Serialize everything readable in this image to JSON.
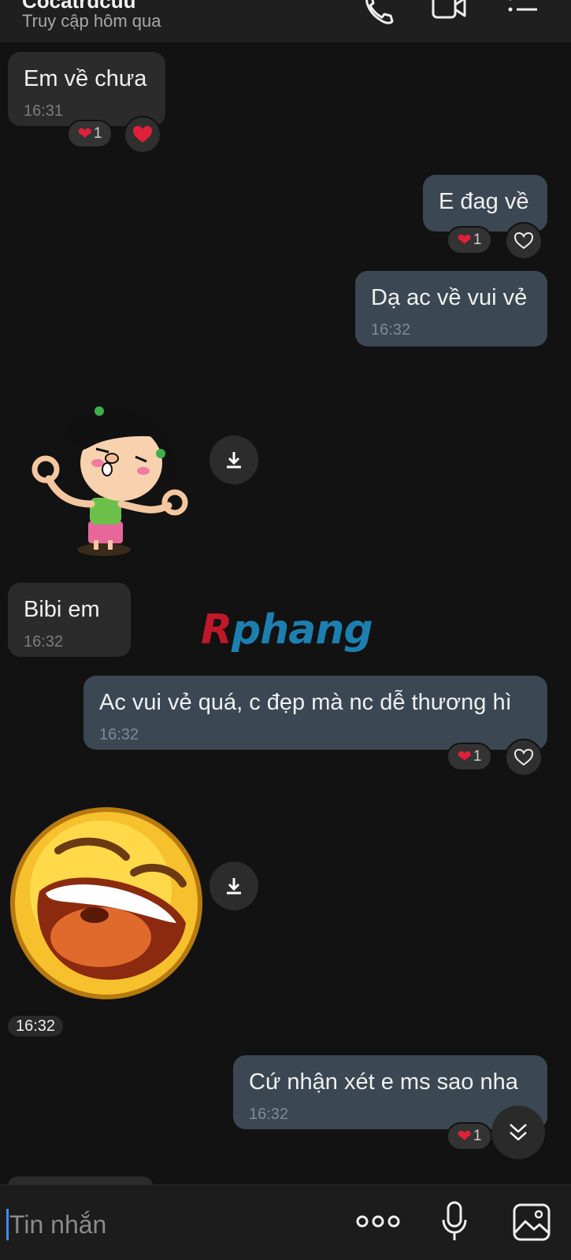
{
  "header": {
    "contact_name": "Cocatrdcuu",
    "last_seen": "Truy cập hôm qua",
    "icons": [
      "phone-icon",
      "video-call-icon",
      "menu-list-icon"
    ]
  },
  "messages": [
    {
      "direction": "in",
      "text": "Em về chưa",
      "time": "16:31",
      "reaction": {
        "emoji": "❤",
        "count": "1"
      }
    },
    {
      "direction": "out",
      "text": "E đag về",
      "time": "",
      "reaction": {
        "emoji": "❤",
        "count": "1"
      }
    },
    {
      "direction": "out",
      "text": "Dạ ac về vui vẻ",
      "time": "16:32"
    },
    {
      "direction": "in",
      "type": "sticker",
      "sticker": "girl-ok-sticker"
    },
    {
      "direction": "in",
      "text": "Bibi em",
      "time": "16:32"
    },
    {
      "direction": "out",
      "text": "Ac vui vẻ quá, c đẹp mà nc dễ thương hì",
      "time": "16:32",
      "reaction": {
        "emoji": "❤",
        "count": "1"
      }
    },
    {
      "direction": "in",
      "type": "sticker",
      "sticker": "laughing-face-sticker",
      "time": "16:32"
    },
    {
      "direction": "out",
      "text": "Cứ nhận xét e ms sao nha",
      "time": "16:32",
      "reaction": {
        "emoji": "❤",
        "count": "1"
      }
    }
  ],
  "watermark": {
    "part1": "R",
    "part2": "phang"
  },
  "composer": {
    "placeholder": "Tin nhắn"
  },
  "colors": {
    "incoming_bubble": "#2b2b2b",
    "outgoing_bubble": "#3b4752",
    "heart": "#e0203a",
    "background": "#121212",
    "cursor": "#3f8ef0"
  }
}
